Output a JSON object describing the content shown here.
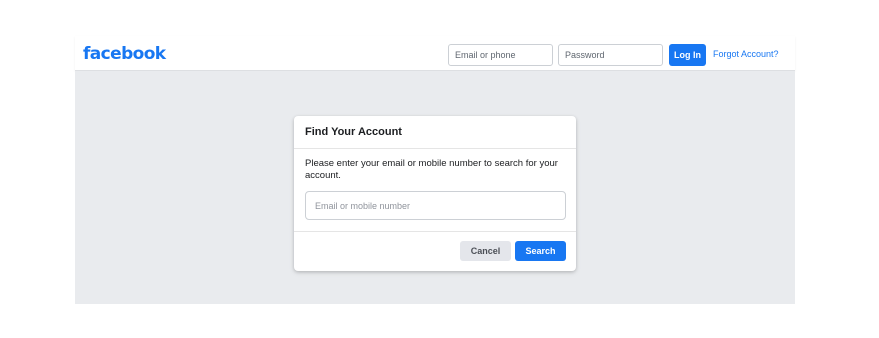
{
  "header": {
    "logo": "facebook",
    "email_placeholder": "Email or phone",
    "password_placeholder": "Password",
    "login_label": "Log In",
    "forgot_link": "Forgot Account?"
  },
  "dialog": {
    "title": "Find Your Account",
    "description": "Please enter your email or mobile number to search for your account.",
    "input_placeholder": "Email or mobile number",
    "cancel_label": "Cancel",
    "search_label": "Search"
  },
  "colors": {
    "brand": "#1877f2",
    "background": "#e9ebee",
    "cancel_bg": "#e4e6eb"
  }
}
